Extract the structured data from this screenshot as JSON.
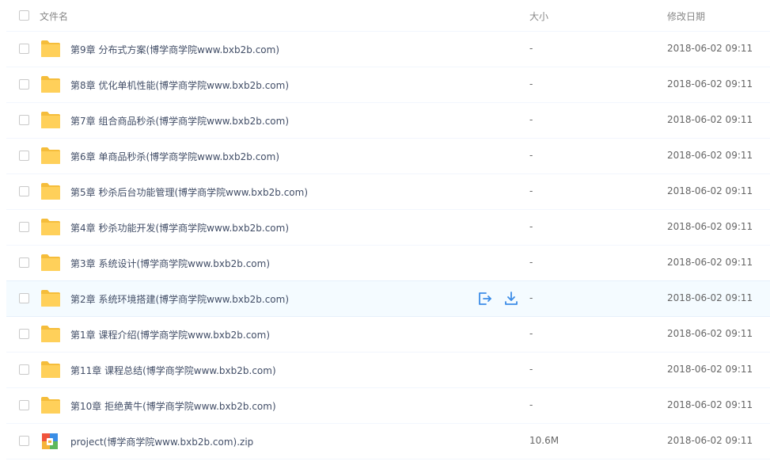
{
  "header": {
    "name_label": "文件名",
    "size_label": "大小",
    "date_label": "修改日期"
  },
  "colors": {
    "folder": "#ffd05a",
    "folder_tab": "#f5bd3b",
    "action_icon": "#3c8ce7",
    "hover_row": "#f4fbff"
  },
  "files": [
    {
      "name": "第9章 分布式方案(博学商学院www.bxb2b.com)",
      "size": "-",
      "date": "2018-06-02 09:11",
      "icon": "folder-icon"
    },
    {
      "name": "第8章 优化单机性能(博学商学院www.bxb2b.com)",
      "size": "-",
      "date": "2018-06-02 09:11",
      "icon": "folder-icon"
    },
    {
      "name": "第7章 组合商品秒杀(博学商学院www.bxb2b.com)",
      "size": "-",
      "date": "2018-06-02 09:11",
      "icon": "folder-icon"
    },
    {
      "name": "第6章 单商品秒杀(博学商学院www.bxb2b.com)",
      "size": "-",
      "date": "2018-06-02 09:11",
      "icon": "folder-icon"
    },
    {
      "name": "第5章 秒杀后台功能管理(博学商学院www.bxb2b.com)",
      "size": "-",
      "date": "2018-06-02 09:11",
      "icon": "folder-icon"
    },
    {
      "name": "第4章 秒杀功能开发(博学商学院www.bxb2b.com)",
      "size": "-",
      "date": "2018-06-02 09:11",
      "icon": "folder-icon"
    },
    {
      "name": "第3章 系统设计(博学商学院www.bxb2b.com)",
      "size": "-",
      "date": "2018-06-02 09:11",
      "icon": "folder-icon"
    },
    {
      "name": "第2章 系统环境搭建(博学商学院www.bxb2b.com)",
      "size": "-",
      "date": "2018-06-02 09:11",
      "icon": "folder-icon",
      "hovered": true
    },
    {
      "name": "第1章 课程介绍(博学商学院www.bxb2b.com)",
      "size": "-",
      "date": "2018-06-02 09:11",
      "icon": "folder-icon"
    },
    {
      "name": "第11章 课程总结(博学商学院www.bxb2b.com)",
      "size": "-",
      "date": "2018-06-02 09:11",
      "icon": "folder-icon"
    },
    {
      "name": "第10章 拒绝黄牛(博学商学院www.bxb2b.com)",
      "size": "-",
      "date": "2018-06-02 09:11",
      "icon": "folder-icon"
    },
    {
      "name": "project(博学商学院www.bxb2b.com).zip",
      "size": "10.6M",
      "date": "2018-06-02 09:11",
      "icon": "zip-icon"
    }
  ]
}
